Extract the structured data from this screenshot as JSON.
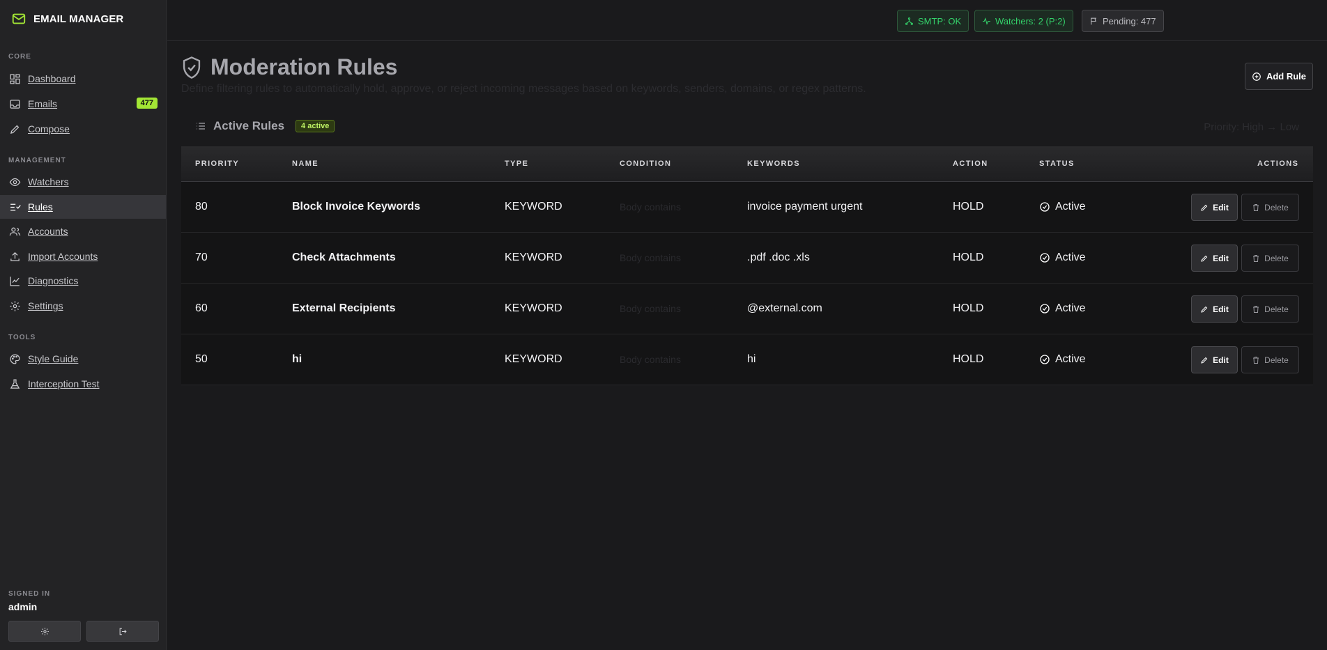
{
  "sidebar": {
    "brand": "EMAIL MANAGER",
    "sections": {
      "core": "CORE",
      "management": "MANAGEMENT",
      "tools": "TOOLS"
    },
    "items": [
      {
        "label": "Dashboard"
      },
      {
        "label": "Emails",
        "badge": "477"
      },
      {
        "label": "Compose"
      },
      {
        "label": "Watchers"
      },
      {
        "label": "Rules"
      },
      {
        "label": "Accounts"
      },
      {
        "label": "Import Accounts"
      },
      {
        "label": "Diagnostics"
      },
      {
        "label": "Settings"
      },
      {
        "label": "Style Guide"
      },
      {
        "label": "Interception Test"
      }
    ],
    "signed_in_label": "SIGNED IN",
    "user": "admin"
  },
  "topbar": {
    "smtp": "SMTP: OK",
    "watchers": "Watchers: 2 (P:2)",
    "pending": "Pending: 477"
  },
  "page": {
    "title": "Moderation Rules",
    "subtitle": "Define filtering rules to automatically hold, approve, or reject incoming messages based on keywords, senders, domains, or regex patterns.",
    "add_rule": "Add Rule",
    "active_title": "Active Rules",
    "active_badge": "4 active",
    "priority_hint": "Priority: High → Low"
  },
  "table": {
    "headers": {
      "priority": "PRIORITY",
      "name": "NAME",
      "type": "TYPE",
      "condition": "CONDITION",
      "keywords": "KEYWORDS",
      "action": "ACTION",
      "status": "STATUS",
      "actions": "ACTIONS"
    },
    "edit_label": "Edit",
    "delete_label": "Delete",
    "rows": [
      {
        "priority": "80",
        "name": "Block Invoice Keywords",
        "type": "KEYWORD",
        "condition": "Body contains",
        "keywords": "invoice payment urgent",
        "action": "HOLD",
        "status": "Active"
      },
      {
        "priority": "70",
        "name": "Check Attachments",
        "type": "KEYWORD",
        "condition": "Body contains",
        "keywords": ".pdf .doc .xls",
        "action": "HOLD",
        "status": "Active"
      },
      {
        "priority": "60",
        "name": "External Recipients",
        "type": "KEYWORD",
        "condition": "Body contains",
        "keywords": "@external.com",
        "action": "HOLD",
        "status": "Active"
      },
      {
        "priority": "50",
        "name": "hi",
        "type": "KEYWORD",
        "condition": "Body contains",
        "keywords": "hi",
        "action": "HOLD",
        "status": "Active"
      }
    ]
  },
  "colors": {
    "accent": "#a3e635",
    "ok": "#34d36b",
    "background": "#1a1a1c"
  }
}
